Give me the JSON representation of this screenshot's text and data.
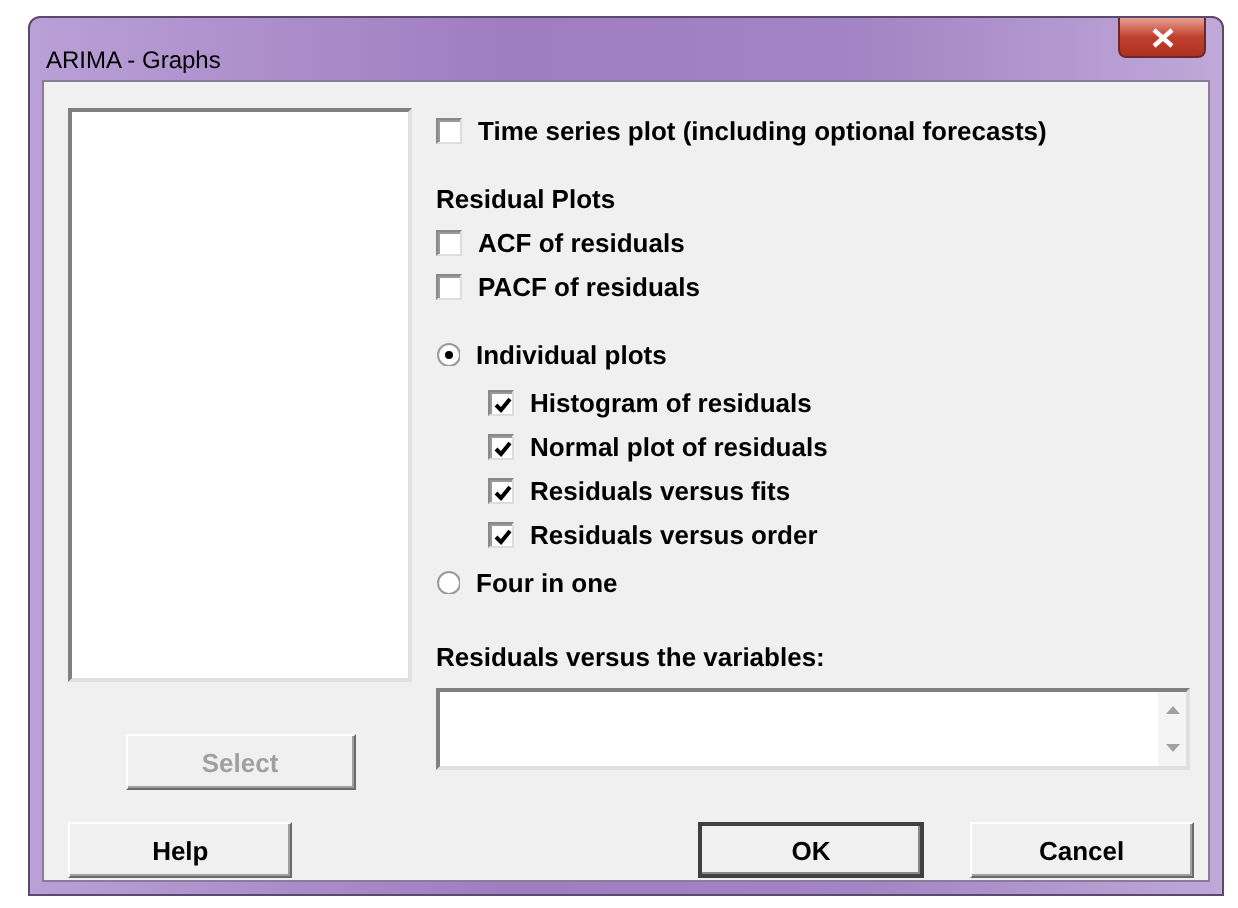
{
  "window": {
    "title": "ARIMA - Graphs"
  },
  "options": [
    {
      "kind": "checkbox",
      "label": "Time series plot (including optional forecasts)",
      "checked": false
    },
    {
      "kind": "heading",
      "label": "Residual Plots"
    },
    {
      "kind": "checkbox",
      "label": "ACF of residuals",
      "checked": false
    },
    {
      "kind": "checkbox",
      "label": "PACF of residuals",
      "checked": false
    },
    {
      "kind": "radio",
      "label": "Individual plots",
      "selected": true,
      "children": [
        {
          "kind": "checkbox",
          "label": "Histogram of residuals",
          "checked": true
        },
        {
          "kind": "checkbox",
          "label": "Normal plot of residuals",
          "checked": true
        },
        {
          "kind": "checkbox",
          "label": "Residuals versus fits",
          "checked": true
        },
        {
          "kind": "checkbox",
          "label": "Residuals versus order",
          "checked": true
        }
      ]
    },
    {
      "kind": "radio",
      "label": "Four in one",
      "selected": false
    }
  ],
  "variables_field": {
    "label": "Residuals versus the variables:"
  },
  "select_button": {
    "label": "Select",
    "disabled": true
  },
  "buttons": [
    {
      "label": "Help",
      "default": false
    },
    {
      "label": "OK",
      "default": true
    },
    {
      "label": "Cancel",
      "default": false
    }
  ]
}
